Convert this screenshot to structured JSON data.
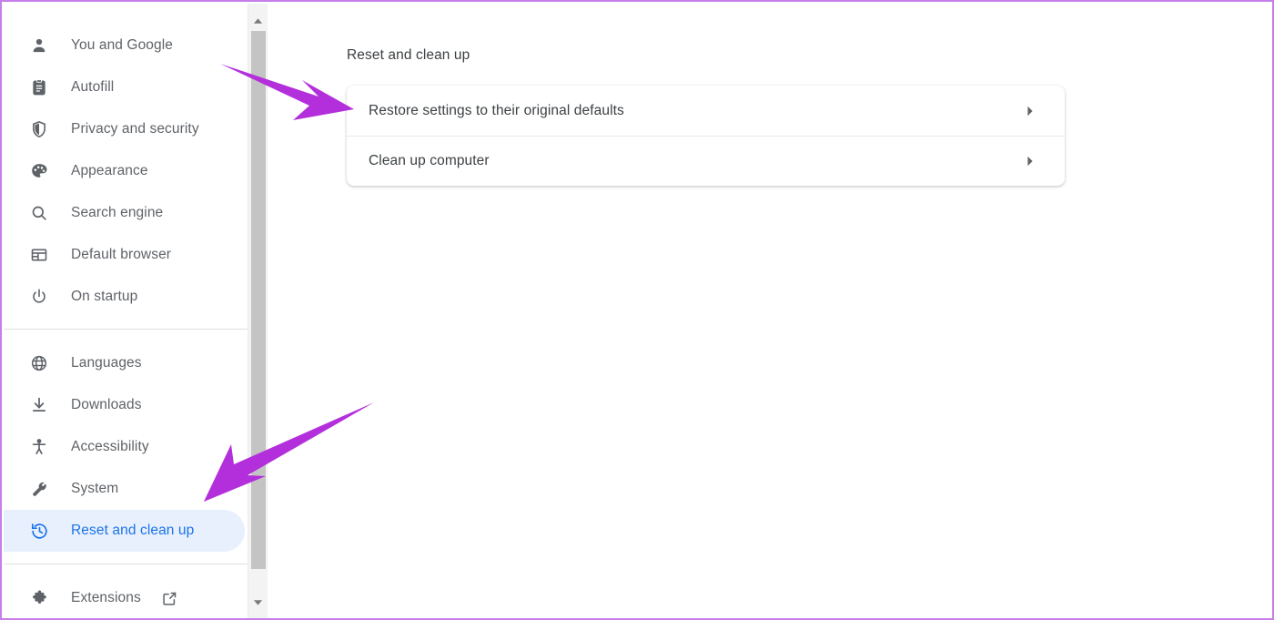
{
  "window": {
    "border_color": "#c77ee8",
    "background": "#ffffff"
  },
  "sidebar": {
    "groups": [
      {
        "items": [
          {
            "label": "You and Google",
            "icon": "person-icon",
            "selected": false
          },
          {
            "label": "Autofill",
            "icon": "clipboard-icon",
            "selected": false
          },
          {
            "label": "Privacy and security",
            "icon": "shield-icon",
            "selected": false
          },
          {
            "label": "Appearance",
            "icon": "palette-icon",
            "selected": false
          },
          {
            "label": "Search engine",
            "icon": "search-icon",
            "selected": false
          },
          {
            "label": "Default browser",
            "icon": "browser-window-icon",
            "selected": false
          },
          {
            "label": "On startup",
            "icon": "power-icon",
            "selected": false
          }
        ]
      },
      {
        "items": [
          {
            "label": "Languages",
            "icon": "globe-icon",
            "selected": false
          },
          {
            "label": "Downloads",
            "icon": "download-icon",
            "selected": false
          },
          {
            "label": "Accessibility",
            "icon": "accessibility-icon",
            "selected": false
          },
          {
            "label": "System",
            "icon": "wrench-icon",
            "selected": false
          },
          {
            "label": "Reset and clean up",
            "icon": "restore-history-icon",
            "selected": true
          }
        ]
      },
      {
        "items": [
          {
            "label": "Extensions",
            "icon": "puzzle-piece-icon",
            "selected": false,
            "external_link": true
          }
        ]
      }
    ],
    "selected_item_background": "#e8f0fe",
    "selected_item_color": "#1a73e8",
    "item_color": "#5f6368"
  },
  "scrollbar": {
    "up_arrow": "scroll-up-arrow-icon",
    "down_arrow": "scroll-down-arrow-icon",
    "track_color": "#f3f3f3",
    "thumb_color": "#c4c4c4"
  },
  "main": {
    "section_title": "Reset and clean up",
    "card_rows": [
      {
        "label": "Restore settings to their original defaults",
        "chevron": "chevron-right-icon"
      },
      {
        "label": "Clean up computer",
        "chevron": "chevron-right-icon"
      }
    ]
  },
  "annotations": {
    "color": "#b32fdb",
    "arrows": [
      {
        "name": "arrow-to-restore-settings",
        "points_to": "Restore settings to their original defaults"
      },
      {
        "name": "arrow-to-reset-and-clean-up",
        "points_to": "Reset and clean up"
      }
    ]
  }
}
